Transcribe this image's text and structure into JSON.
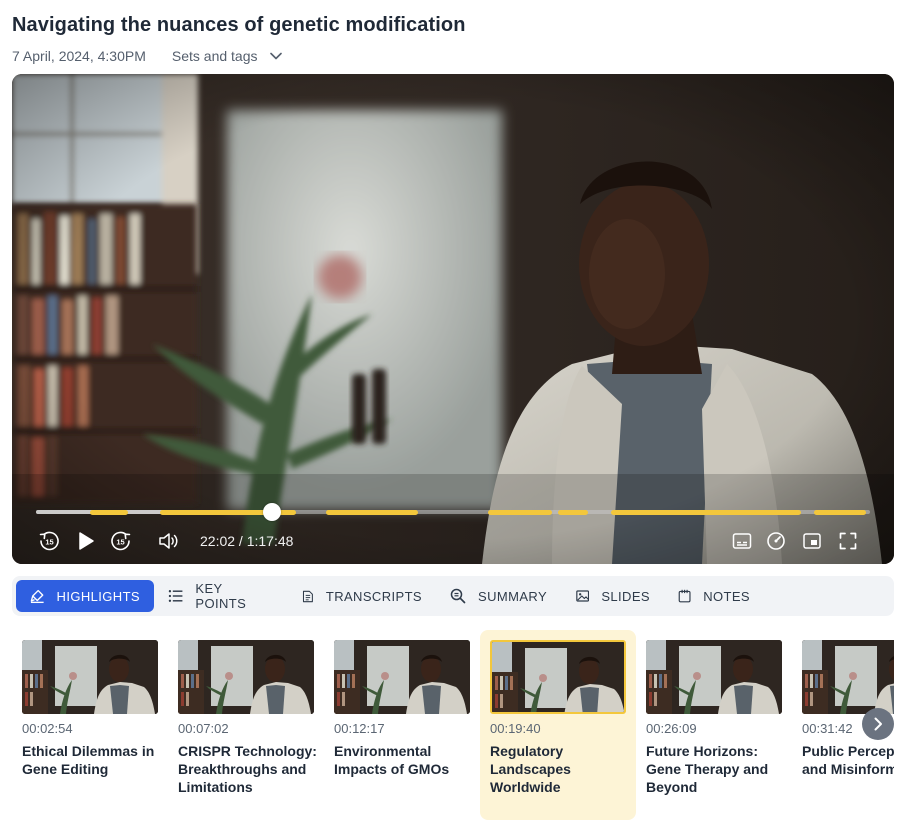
{
  "header": {
    "title": "Navigating the nuances of genetic modification",
    "date": "7 April, 2024, 4:30PM",
    "sets_label": "Sets and tags"
  },
  "player": {
    "current_time": "22:02",
    "separator": " / ",
    "duration": "1:17:48",
    "time_display": "22:02 / 1:17:48",
    "progress_fraction": 0.283,
    "highlight_color": "#f3c73c",
    "icons": [
      "rewind-15-icon",
      "play-icon",
      "forward-15-icon",
      "volume-icon",
      "captions-icon",
      "speed-icon",
      "picture-in-picture-icon",
      "fullscreen-icon"
    ],
    "skip_label": "15"
  },
  "tabs": [
    {
      "label": "HIGHLIGHTS",
      "icon": "highlighter-icon",
      "active": true
    },
    {
      "label": "KEY POINTS",
      "icon": "list-icon",
      "active": false
    },
    {
      "label": "TRANSCRIPTS",
      "icon": "document-icon",
      "active": false
    },
    {
      "label": "SUMMARY",
      "icon": "search-doc-icon",
      "active": false
    },
    {
      "label": "SLIDES",
      "icon": "image-icon",
      "active": false
    },
    {
      "label": "NOTES",
      "icon": "notepad-icon",
      "active": false
    }
  ],
  "highlights": [
    {
      "time": "00:02:54",
      "title": "Ethical Dilemmas in Gene Editing"
    },
    {
      "time": "00:07:02",
      "title": "CRISPR Technology: Breakthroughs and Limitations"
    },
    {
      "time": "00:12:17",
      "title": "Environmental Impacts of GMOs"
    },
    {
      "time": "00:19:40",
      "title": "Regulatory Landscapes Worldwide",
      "selected": true
    },
    {
      "time": "00:26:09",
      "title": "Future Horizons: Gene Therapy and Beyond"
    },
    {
      "time": "00:31:42",
      "title": "Public Perception and Misinformation"
    }
  ],
  "colors": {
    "accent": "#2f5fe0",
    "highlight": "#f3c73c",
    "selected_card_bg": "#fdf4d6"
  }
}
